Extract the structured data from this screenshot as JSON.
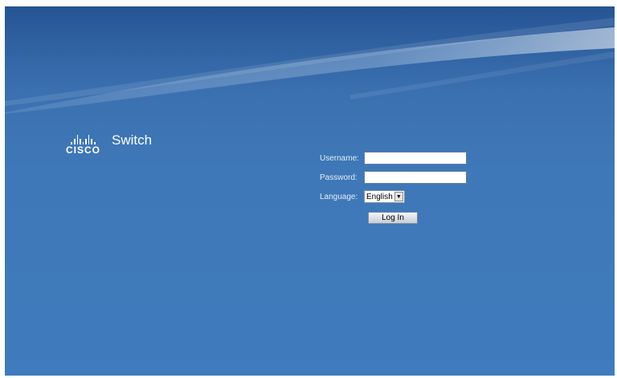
{
  "brand": {
    "logo_text": "CISCO",
    "product": "Switch"
  },
  "login": {
    "username_label": "Username:",
    "username_value": "",
    "password_label": "Password:",
    "password_value": "",
    "language_label": "Language:",
    "language_selected": "English",
    "login_button": "Log In"
  },
  "colors": {
    "background": "#3f7bbd",
    "text": "#ffffff"
  },
  "icons": {
    "logo": "cisco-bridge-logo",
    "dropdown": "chevron-down-icon"
  }
}
